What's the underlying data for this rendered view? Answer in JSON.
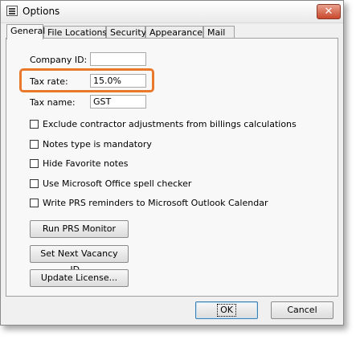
{
  "window": {
    "title": "Options",
    "close_label": "✕"
  },
  "tabs": [
    {
      "label": "General",
      "active": true
    },
    {
      "label": "File Locations",
      "active": false
    },
    {
      "label": "Security",
      "active": false
    },
    {
      "label": "Appearance",
      "active": false
    },
    {
      "label": "Mail",
      "active": false
    }
  ],
  "fields": {
    "company_id": {
      "label": "Company ID:",
      "value": ""
    },
    "tax_rate": {
      "label": "Tax rate:",
      "value": "15.0%"
    },
    "tax_name": {
      "label": "Tax name:",
      "value": "GST"
    }
  },
  "checkboxes": [
    {
      "label": "Exclude  contractor adjustments from billings calculations",
      "checked": false
    },
    {
      "label": "Notes type is mandatory",
      "checked": false
    },
    {
      "label": "Hide Favorite notes",
      "checked": false
    },
    {
      "label": "Use Microsoft Office spell checker",
      "checked": false
    },
    {
      "label": "Write PRS reminders to Microsoft Outlook Calendar",
      "checked": false
    }
  ],
  "buttons": {
    "run_prs_monitor": "Run PRS Monitor",
    "set_next_vacancy": "Set Next Vacancy ID...",
    "update_license": "Update License...",
    "ok": "OK",
    "cancel": "Cancel"
  },
  "colors": {
    "highlight": "#e8782a",
    "close_button": "#c9482c"
  }
}
